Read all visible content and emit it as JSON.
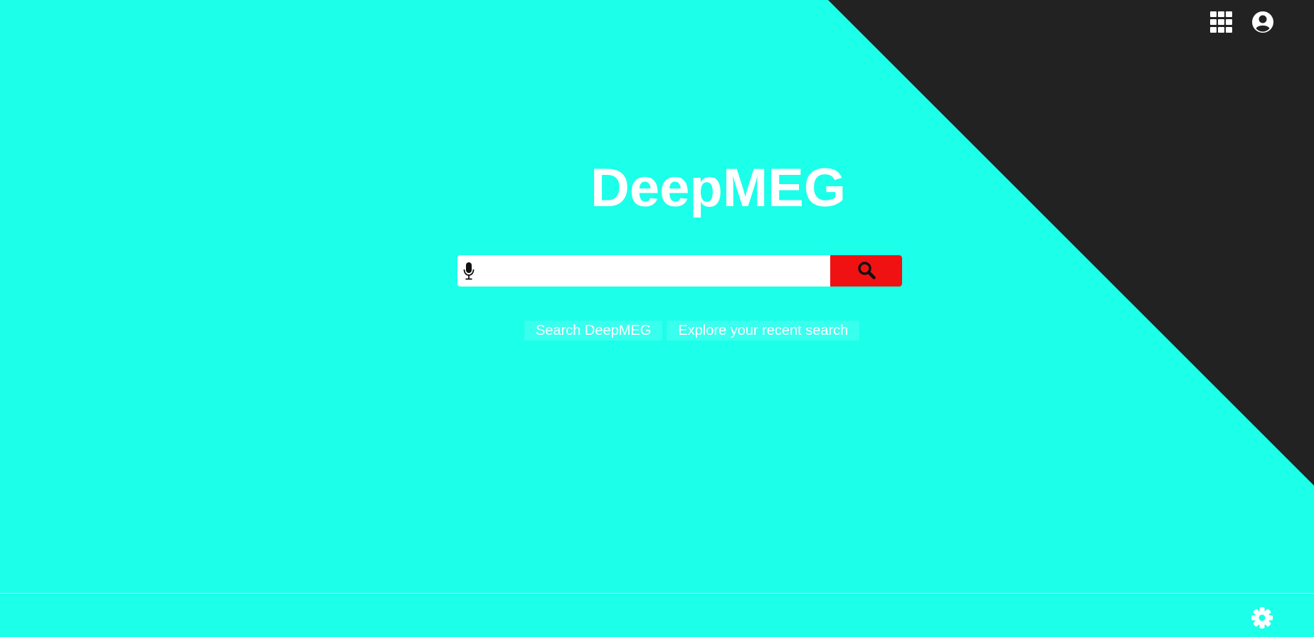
{
  "app": {
    "logo_text": "DeepMEG"
  },
  "header": {
    "icons": [
      "apps-grid-icon",
      "account-circle-icon"
    ]
  },
  "search": {
    "value": "",
    "placeholder": "",
    "mic_icon": "microphone-icon",
    "button_icon": "search-icon"
  },
  "links": {
    "search_label": "Search DeepMEG",
    "explore_label": "Explore your recent search"
  },
  "footer": {
    "settings_icon": "gear-icon"
  },
  "colors": {
    "background": "#1cffe9",
    "corner": "#222222",
    "search_button": "#f01212",
    "text": "#ffffff"
  }
}
